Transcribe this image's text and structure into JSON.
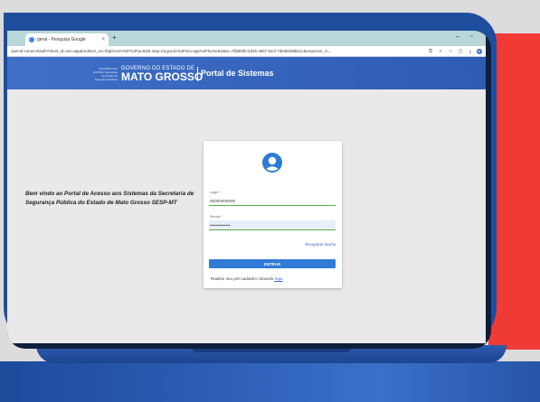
{
  "browser": {
    "tab_title": "geral - Pesquisa Google",
    "tab_close": "×",
    "new_tab": "+",
    "minimize": "–",
    "maximize": "▫",
    "url": "openid-connect/auth?client_id=sso-app&redirect_uri=https%3A%2F%2Fportal2.sesp.mt.gov.br%2Fsso-app%2Fhome&state=7db8b0b-bd35-4567-b4cf-7d8360d6bb1c&response_m..."
  },
  "header": {
    "logo_small": "GOVERNO DO ESTADO Secretaria de Estado de Segurança Pública",
    "logo_gov": "GOVERNO DO ESTADO DE",
    "logo_state": "MATO GROSSO",
    "portal_title": "Portal de Sistemas"
  },
  "welcome_text": "Bem vindo ao Portal de Acesso aos Sistemas da Secretaria de Segurança Pública do Estado de Mato Grosso SESP-MT",
  "login": {
    "login_label": "Login *",
    "login_value": "00000000000",
    "password_label": "Senha *",
    "password_value": "••••••••••••••",
    "recover_link": "Recuperar Senha",
    "submit_label": "ENTRAR",
    "signup_text": "Realize seu pré-cadastro clicando",
    "signup_link": "Aqui"
  },
  "colors": {
    "header_blue": "#2e5bb3",
    "button_blue": "#2f7bd6",
    "input_underline": "#5aa94b",
    "accent_red": "#f03a36"
  }
}
